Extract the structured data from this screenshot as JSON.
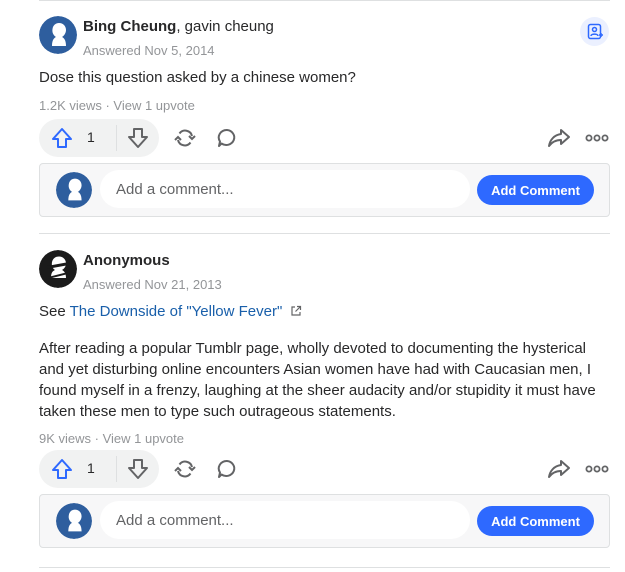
{
  "answers": [
    {
      "author_name": "Bing Cheung",
      "author_credential": ", gavin cheung",
      "date": "Answered Nov 5, 2014",
      "body": "Dose this question asked by a chinese women?",
      "stats": "1.2K views · View 1 upvote",
      "upvotes": "1",
      "comment_placeholder": "Add a comment...",
      "comment_button": "Add Comment",
      "avatar_icon": "default-avatar-icon",
      "follow_icon": "follow-person-icon"
    },
    {
      "author_name": "Anonymous",
      "date": "Answered Nov 21, 2013",
      "see_prefix": "See",
      "see_link": "The Downside of \"Yellow Fever\"",
      "body": "After reading a popular Tumblr page, wholly devoted to documenting the hysterical and yet disturbing online encounters Asian women have had with Caucasian men, I found myself in a frenzy, laughing at the sheer audacity and/or stupidity it must have taken these men to type such outrageous statements.",
      "stats": "9K views · View 1 upvote",
      "upvotes": "1",
      "comment_placeholder": "Add a comment...",
      "comment_button": "Add Comment",
      "avatar_icon": "anonymous-avatar-icon"
    }
  ],
  "colors": {
    "accent": "#2e69ff",
    "link": "#195faa",
    "muted": "#939598",
    "vote_bg": "#f1f2f2",
    "avatar_blue": "#2e5e9e"
  }
}
